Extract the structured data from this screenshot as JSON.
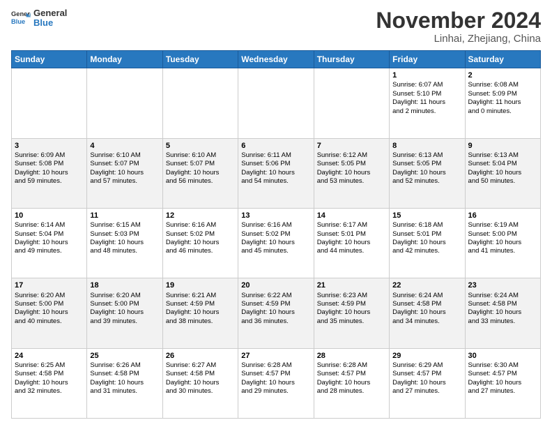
{
  "header": {
    "logo_line1": "General",
    "logo_line2": "Blue",
    "month": "November 2024",
    "location": "Linhai, Zhejiang, China"
  },
  "days_of_week": [
    "Sunday",
    "Monday",
    "Tuesday",
    "Wednesday",
    "Thursday",
    "Friday",
    "Saturday"
  ],
  "weeks": [
    [
      {
        "day": "",
        "content": ""
      },
      {
        "day": "",
        "content": ""
      },
      {
        "day": "",
        "content": ""
      },
      {
        "day": "",
        "content": ""
      },
      {
        "day": "",
        "content": ""
      },
      {
        "day": "1",
        "content": "Sunrise: 6:07 AM\nSunset: 5:10 PM\nDaylight: 11 hours\nand 2 minutes."
      },
      {
        "day": "2",
        "content": "Sunrise: 6:08 AM\nSunset: 5:09 PM\nDaylight: 11 hours\nand 0 minutes."
      }
    ],
    [
      {
        "day": "3",
        "content": "Sunrise: 6:09 AM\nSunset: 5:08 PM\nDaylight: 10 hours\nand 59 minutes."
      },
      {
        "day": "4",
        "content": "Sunrise: 6:10 AM\nSunset: 5:07 PM\nDaylight: 10 hours\nand 57 minutes."
      },
      {
        "day": "5",
        "content": "Sunrise: 6:10 AM\nSunset: 5:07 PM\nDaylight: 10 hours\nand 56 minutes."
      },
      {
        "day": "6",
        "content": "Sunrise: 6:11 AM\nSunset: 5:06 PM\nDaylight: 10 hours\nand 54 minutes."
      },
      {
        "day": "7",
        "content": "Sunrise: 6:12 AM\nSunset: 5:05 PM\nDaylight: 10 hours\nand 53 minutes."
      },
      {
        "day": "8",
        "content": "Sunrise: 6:13 AM\nSunset: 5:05 PM\nDaylight: 10 hours\nand 52 minutes."
      },
      {
        "day": "9",
        "content": "Sunrise: 6:13 AM\nSunset: 5:04 PM\nDaylight: 10 hours\nand 50 minutes."
      }
    ],
    [
      {
        "day": "10",
        "content": "Sunrise: 6:14 AM\nSunset: 5:04 PM\nDaylight: 10 hours\nand 49 minutes."
      },
      {
        "day": "11",
        "content": "Sunrise: 6:15 AM\nSunset: 5:03 PM\nDaylight: 10 hours\nand 48 minutes."
      },
      {
        "day": "12",
        "content": "Sunrise: 6:16 AM\nSunset: 5:02 PM\nDaylight: 10 hours\nand 46 minutes."
      },
      {
        "day": "13",
        "content": "Sunrise: 6:16 AM\nSunset: 5:02 PM\nDaylight: 10 hours\nand 45 minutes."
      },
      {
        "day": "14",
        "content": "Sunrise: 6:17 AM\nSunset: 5:01 PM\nDaylight: 10 hours\nand 44 minutes."
      },
      {
        "day": "15",
        "content": "Sunrise: 6:18 AM\nSunset: 5:01 PM\nDaylight: 10 hours\nand 42 minutes."
      },
      {
        "day": "16",
        "content": "Sunrise: 6:19 AM\nSunset: 5:00 PM\nDaylight: 10 hours\nand 41 minutes."
      }
    ],
    [
      {
        "day": "17",
        "content": "Sunrise: 6:20 AM\nSunset: 5:00 PM\nDaylight: 10 hours\nand 40 minutes."
      },
      {
        "day": "18",
        "content": "Sunrise: 6:20 AM\nSunset: 5:00 PM\nDaylight: 10 hours\nand 39 minutes."
      },
      {
        "day": "19",
        "content": "Sunrise: 6:21 AM\nSunset: 4:59 PM\nDaylight: 10 hours\nand 38 minutes."
      },
      {
        "day": "20",
        "content": "Sunrise: 6:22 AM\nSunset: 4:59 PM\nDaylight: 10 hours\nand 36 minutes."
      },
      {
        "day": "21",
        "content": "Sunrise: 6:23 AM\nSunset: 4:59 PM\nDaylight: 10 hours\nand 35 minutes."
      },
      {
        "day": "22",
        "content": "Sunrise: 6:24 AM\nSunset: 4:58 PM\nDaylight: 10 hours\nand 34 minutes."
      },
      {
        "day": "23",
        "content": "Sunrise: 6:24 AM\nSunset: 4:58 PM\nDaylight: 10 hours\nand 33 minutes."
      }
    ],
    [
      {
        "day": "24",
        "content": "Sunrise: 6:25 AM\nSunset: 4:58 PM\nDaylight: 10 hours\nand 32 minutes."
      },
      {
        "day": "25",
        "content": "Sunrise: 6:26 AM\nSunset: 4:58 PM\nDaylight: 10 hours\nand 31 minutes."
      },
      {
        "day": "26",
        "content": "Sunrise: 6:27 AM\nSunset: 4:58 PM\nDaylight: 10 hours\nand 30 minutes."
      },
      {
        "day": "27",
        "content": "Sunrise: 6:28 AM\nSunset: 4:57 PM\nDaylight: 10 hours\nand 29 minutes."
      },
      {
        "day": "28",
        "content": "Sunrise: 6:28 AM\nSunset: 4:57 PM\nDaylight: 10 hours\nand 28 minutes."
      },
      {
        "day": "29",
        "content": "Sunrise: 6:29 AM\nSunset: 4:57 PM\nDaylight: 10 hours\nand 27 minutes."
      },
      {
        "day": "30",
        "content": "Sunrise: 6:30 AM\nSunset: 4:57 PM\nDaylight: 10 hours\nand 27 minutes."
      }
    ]
  ]
}
